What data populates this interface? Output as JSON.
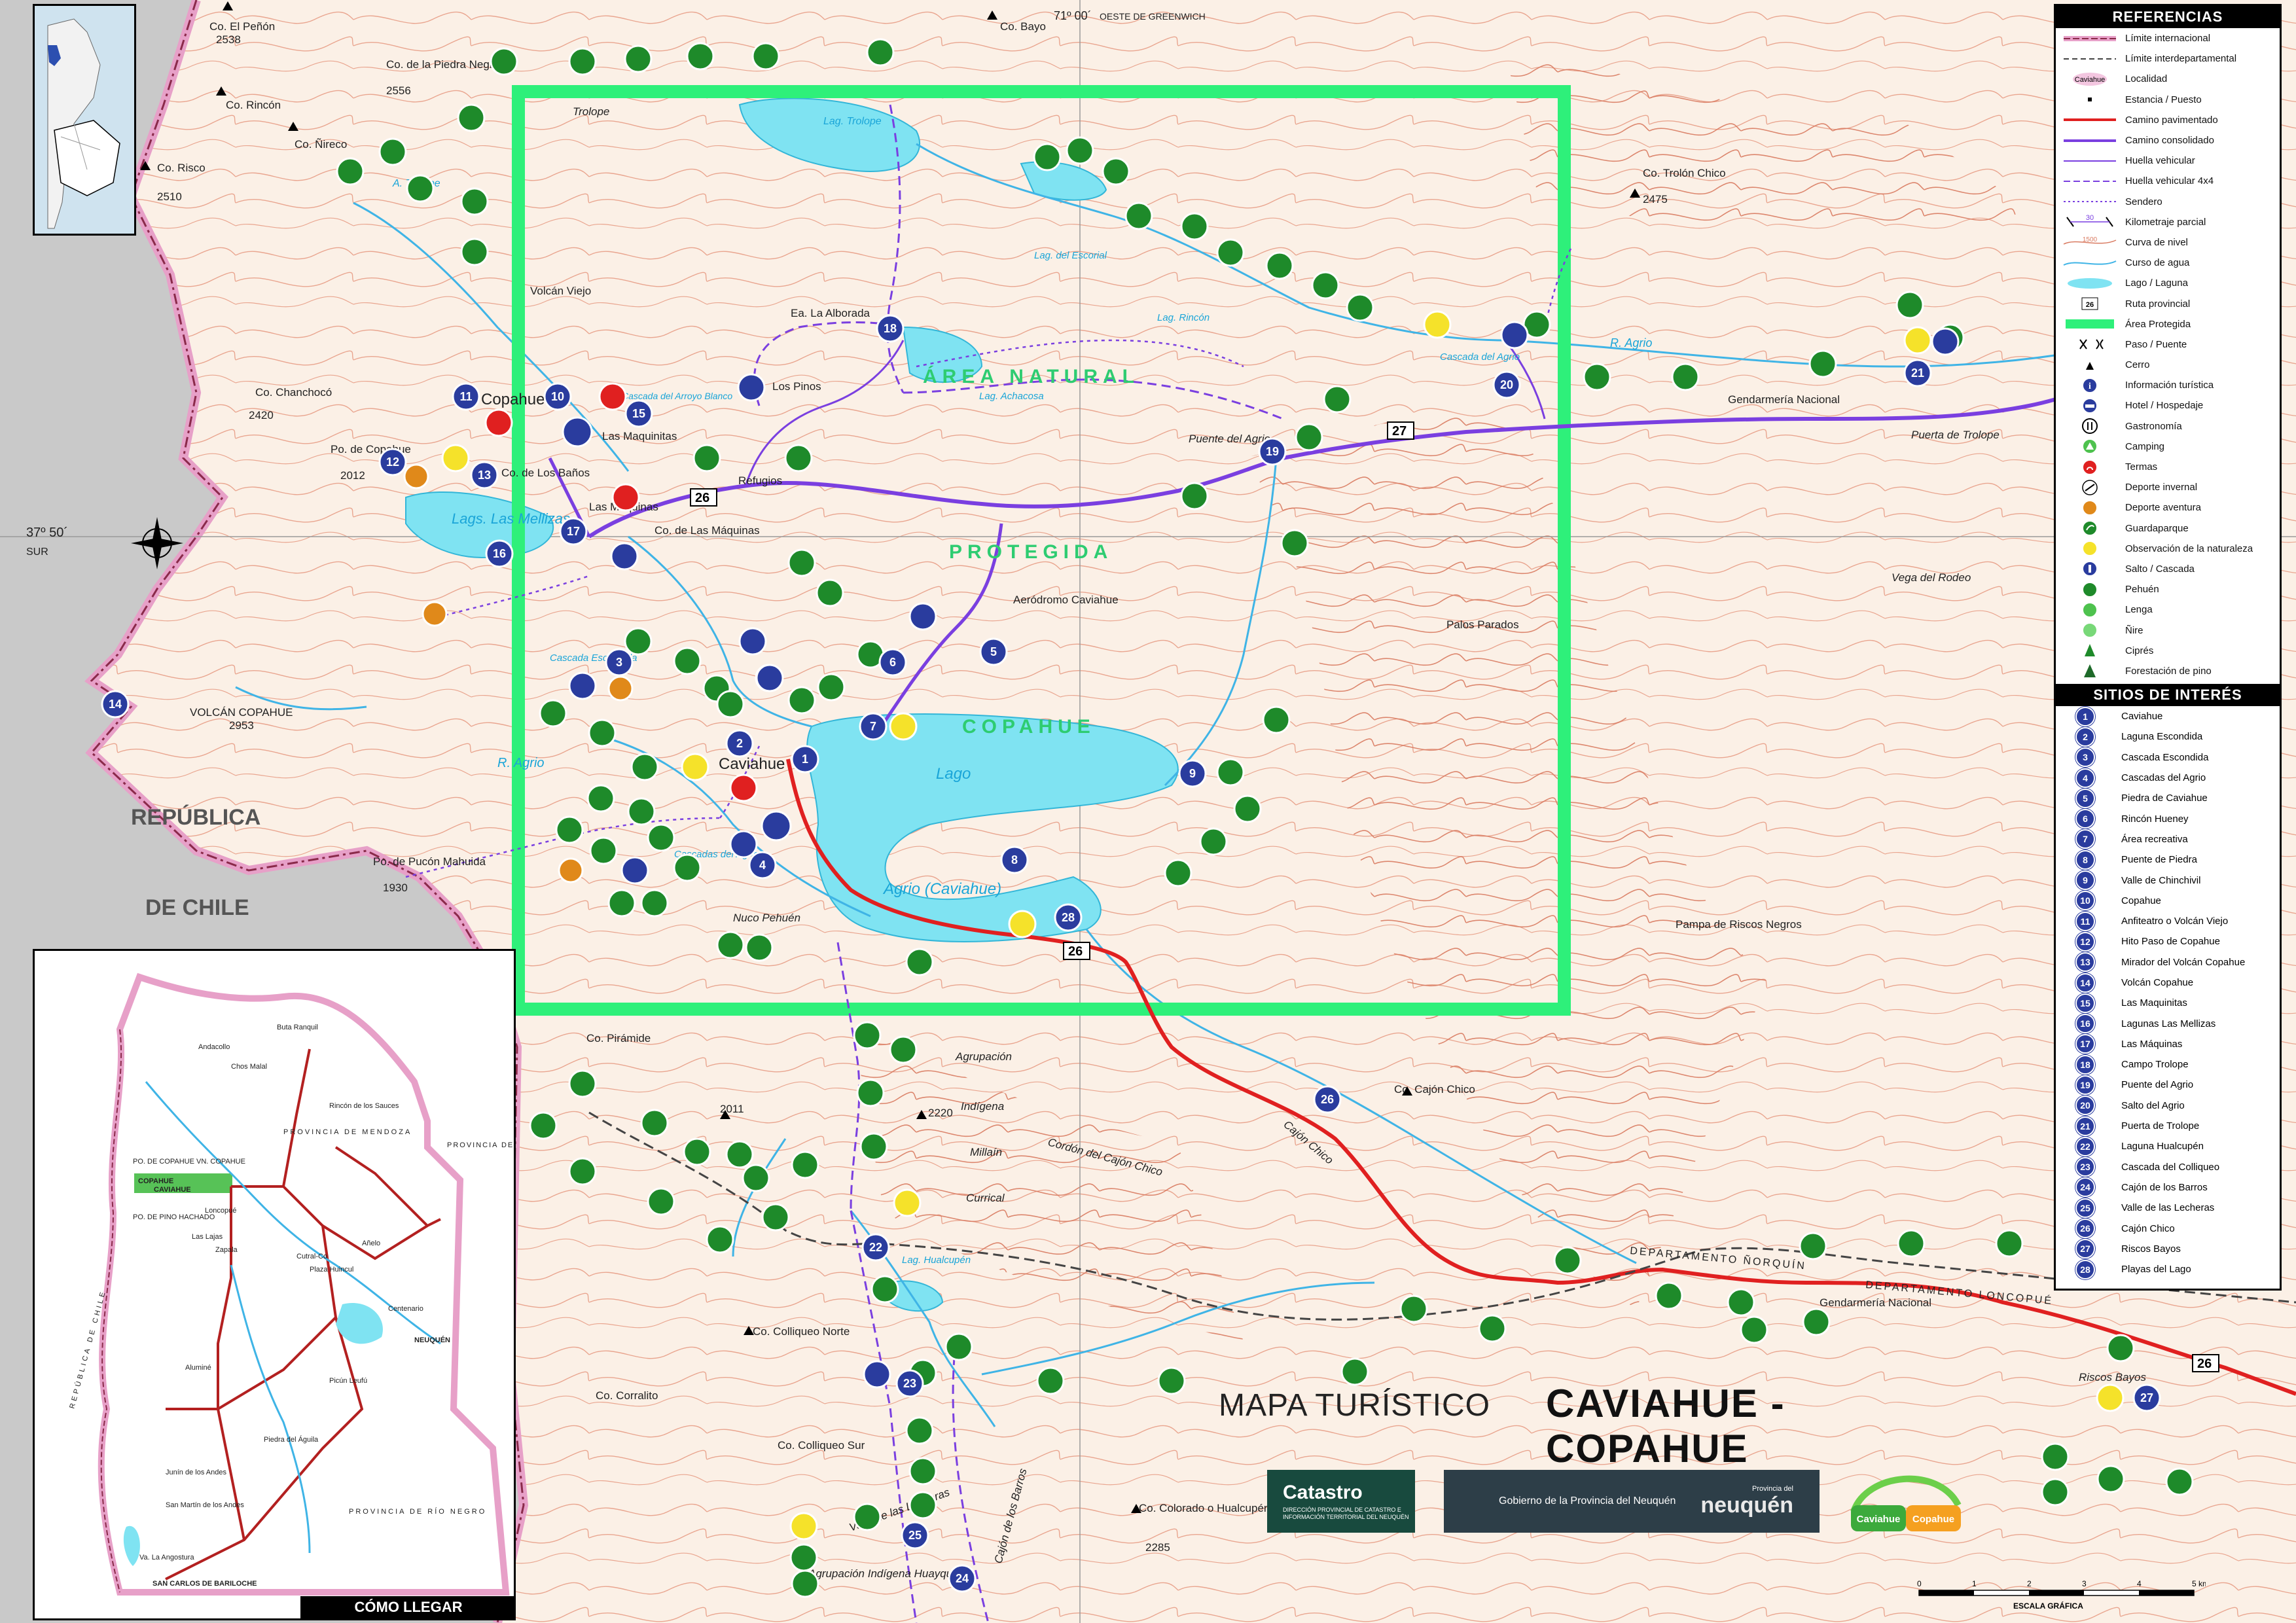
{
  "title": {
    "prefix": "MAPA TURÍSTICO",
    "name": "CAVIAHUE - COPAHUE"
  },
  "logos": {
    "catastro": "Catastro",
    "catastro_sub": "DIRECCIÓN PROVINCIAL DE CATASTRO E INFORMACIÓN TERRITORIAL DEL NEUQUÉN",
    "gobierno": "Gobierno de la Provincia del Neuquén",
    "provincia": "neuquén",
    "provincia_small": "Provincia del",
    "cc_left": "Caviahue",
    "cc_right": "Copahue"
  },
  "legend": {
    "heading": "REFERENCIAS",
    "items": [
      {
        "label": "Límite internacional",
        "sym": "intl"
      },
      {
        "label": "Límite interdepartamental",
        "sym": "dept"
      },
      {
        "label": "Localidad",
        "sym": "town",
        "text": "Caviahue"
      },
      {
        "label": "Estancia / Puesto",
        "sym": "dot"
      },
      {
        "label": "Camino pavimentado",
        "sym": "paved"
      },
      {
        "label": "Camino consolidado",
        "sym": "consol"
      },
      {
        "label": "Huella vehicular",
        "sym": "track"
      },
      {
        "label": "Huella vehicular 4x4",
        "sym": "track4"
      },
      {
        "label": "Sendero",
        "sym": "trail"
      },
      {
        "label": "Kilometraje parcial",
        "sym": "km",
        "text": "30"
      },
      {
        "label": "Curva de nivel",
        "sym": "contour",
        "text": "1500"
      },
      {
        "label": "Curso de agua",
        "sym": "river"
      },
      {
        "label": "Lago / Laguna",
        "sym": "lake"
      },
      {
        "label": "Ruta provincial",
        "sym": "route",
        "text": "26"
      },
      {
        "label": "Área Protegida",
        "sym": "protected"
      },
      {
        "label": "Paso / Puente",
        "sym": "pass"
      },
      {
        "label": "Cerro",
        "sym": "peak"
      },
      {
        "label": "Información turística",
        "sym": "info"
      },
      {
        "label": "Hotel / Hospedaje",
        "sym": "hotel"
      },
      {
        "label": "Gastronomía",
        "sym": "food"
      },
      {
        "label": "Camping",
        "sym": "camping"
      },
      {
        "label": "Termas",
        "sym": "termas"
      },
      {
        "label": "Deporte invernal",
        "sym": "ski"
      },
      {
        "label": "Deporte aventura",
        "sym": "adventure"
      },
      {
        "label": "Guardaparque",
        "sym": "ranger"
      },
      {
        "label": "Observación de la naturaleza",
        "sym": "observe"
      },
      {
        "label": "Salto / Cascada",
        "sym": "waterfall"
      },
      {
        "label": "Pehuén",
        "sym": "pehuen"
      },
      {
        "label": "Lenga",
        "sym": "lenga"
      },
      {
        "label": "Ñire",
        "sym": "nire"
      },
      {
        "label": "Ciprés",
        "sym": "cipres"
      },
      {
        "label": "Forestación de pino",
        "sym": "pino"
      }
    ],
    "sites_heading": "SITIOS DE INTERÉS",
    "sites": [
      "Caviahue",
      "Laguna Escondida",
      "Cascada Escondida",
      "Cascadas del Agrio",
      "Piedra de Caviahue",
      "Rincón Hueney",
      "Área recreativa",
      "Puente de Piedra",
      "Valle de Chinchivil",
      "Copahue",
      "Anfiteatro o Volcán Viejo",
      "Hito Paso de Copahue",
      "Mirador del Volcán Copahue",
      "Volcán Copahue",
      "Las Maquinitas",
      "Lagunas Las Mellizas",
      "Las Máquinas",
      "Campo Trolope",
      "Puente del Agrio",
      "Salto del Agrio",
      "Puerta de Trolope",
      "Laguna Hualcupén",
      "Cascada del Colliqueo",
      "Cajón de los Barros",
      "Valle de las Lecheras",
      "Cajón Chico",
      "Riscos Bayos",
      "Playas del Lago"
    ]
  },
  "inset": {
    "title": "CÓMO LLEGAR",
    "labels": {
      "mendoza": "PROVINCIA DE MENDOZA",
      "pampa": "PROVINCIA DE LA PAMPA",
      "rionegro": "PROVINCIA DE RÍO NEGRO",
      "chile": "REPÚBLICA DE CHILE",
      "neuquen": "NEUQUÉN",
      "copahue": "COPAHUE",
      "caviahue": "CAVIAHUE",
      "bariloche": "SAN CARLOS DE BARILOCHE",
      "zapala": "Zapala",
      "chosmalal": "Chos Malal",
      "junin": "Junín de los Andes",
      "sanmartin": "San Martín de los Andes",
      "alumine": "Aluminé",
      "piedradelaguila": "Piedra del Águila",
      "andacollo": "Andacollo",
      "buta": "Buta Ranquil",
      "rincon": "Rincón de los Sauces",
      "cutral": "Cutral-Co",
      "plaza": "Plaza Huincul",
      "centenario": "Centenario",
      "lonco": "Loncopué",
      "pinohachado": "PO. DE PINO HACHADO",
      "pocopahue": "PO. DE COPAHUE VN. COPAHUE",
      "labia": "Las Lajas",
      "anelo": "Añelo",
      "piciel": "Picún Leufú",
      "villalaangostura": "Va. La Angostura"
    }
  },
  "scale": {
    "ticks": [
      "0",
      "1",
      "2",
      "3",
      "4",
      "5 km"
    ],
    "label": "ESCALA GRÁFICA"
  },
  "map_labels": {
    "area1": "ÁREA NATURAL",
    "area2": "PROTEGIDA",
    "area3": "COPAHUE",
    "chile1": "REPÚBLICA",
    "chile2": "DE CHILE",
    "lat": "37º 50´",
    "sur": "SUR",
    "lon": "71º 00´",
    "oeste": "OESTE DE GREENWICH",
    "copahue_town": "Copahue",
    "caviahue_town": "Caviahue",
    "lago_caviahue": "Lago",
    "agrio_caviahue": "Agrio (Caviahue)",
    "lag_trolope": "Lag. Trolope",
    "lags_mellizas": "Lags. Las Mellizas",
    "co_penon": "Co. El Peñón",
    "co_penon_h": "2538",
    "co_piedra": "Co. de la Piedra Negra",
    "co_piedra_h": "2556",
    "co_rincon": "Co. Rincón",
    "co_nireco": "Co. Ñireco",
    "co_risco": "Co. Risco",
    "co_risco_h": "2510",
    "co_bayo": "Co. Bayo",
    "trolope": "Trolope",
    "volcan_viejo": "Volcán Viejo",
    "co_chanchoco": "Co. Chanchocó",
    "co_chanchoco_h": "2420",
    "po_copahue": "Po. de Copahue",
    "po_copahue_h": "2012",
    "volcan_copahue": "VOLCÁN COPAHUE",
    "volcan_copahue_h": "2953",
    "po_pucon": "Po. de Pucón Mahuida",
    "po_pucon_h": "1930",
    "las_maquinitas": "Las Maquinitas",
    "co_banos": "Co. de Los Baños",
    "las_maquinas": "Las Máquinas",
    "co_las_maquinas": "Co. de Las Máquinas",
    "refugios": "Refugios",
    "los_pinos": "Los Pinos",
    "ea_alborada": "Ea. La Alborada",
    "puente_agrio": "Puente del Agrio",
    "aerodromo": "Aeródromo Caviahue",
    "nuco": "Nuco Pehuén",
    "palos_parados": "Palos Parados",
    "vega_rodeo": "Vega del Rodeo",
    "pampa_riscos": "Pampa de Riscos Negros",
    "gendarmeria1": "Gendarmería Nacional",
    "gendarmeria2": "Gendarmería Nacional",
    "puerta_trolope": "Puerta de Trolope",
    "co_trolon": "Co. Trolón Chico",
    "co_trolon_h": "2475",
    "cajon_chico": "Cajón Chico",
    "co_cajon_chico": "Co. Cajón Chico",
    "co_piramide": "Co. Pirámide",
    "agrupacion": "Agrupación",
    "indigena": "Indígena",
    "millain": "Millaín",
    "currical": "Currical",
    "cordon": "Cordón del Cajón Chico",
    "co_colliqueo_norte": "Co. Colliqueo Norte",
    "co_corrallito": "Co. Corralito",
    "co_colliqueo_sur": "Co. Colliqueo Sur",
    "co_colorado": "Co. Colorado o Hualcupén",
    "co_colorado_h": "2285",
    "cajon_barros": "Cajón de los Barros",
    "valle_lecheras": "Valle de las Lecheras",
    "agrupacion2": "Agrupación Indígena Huayquillán",
    "riscos_bayos": "Riscos Bayos",
    "dep_norquin": "DEPARTAMENTO ÑORQUÍN",
    "dep_loncopue": "DEPARTAMENTO LONCOPUÉ",
    "r_agrio": "R. Agrio",
    "a_trolope": "A. Trolope",
    "lag_escorial": "Lag. del Escorial",
    "lag_rincon": "Lag. Rincón",
    "lag_achacosa": "Lag. Achacosa",
    "lag_hualcupen": "Lag. Hualcupén",
    "cascada_escondida": "Cascada Escondida",
    "cascadas_agrio": "Cascadas del Agrio",
    "cascada_agrio": "Cascada del Agrio",
    "cascada_arroyo_blanco": "Cascada del Arroyo Blanco",
    "route_26": "26",
    "route_27": "27",
    "elev_2011": "2011",
    "elev_2220": "2220"
  },
  "colors": {
    "protected": "#2ef07a",
    "paved": "#e02020",
    "consolidated": "#7a3fe0",
    "site": "#2a3c9e",
    "lake": "#7fe3f2",
    "contour": "#e8a08a",
    "tree": "#1e8a2a"
  }
}
